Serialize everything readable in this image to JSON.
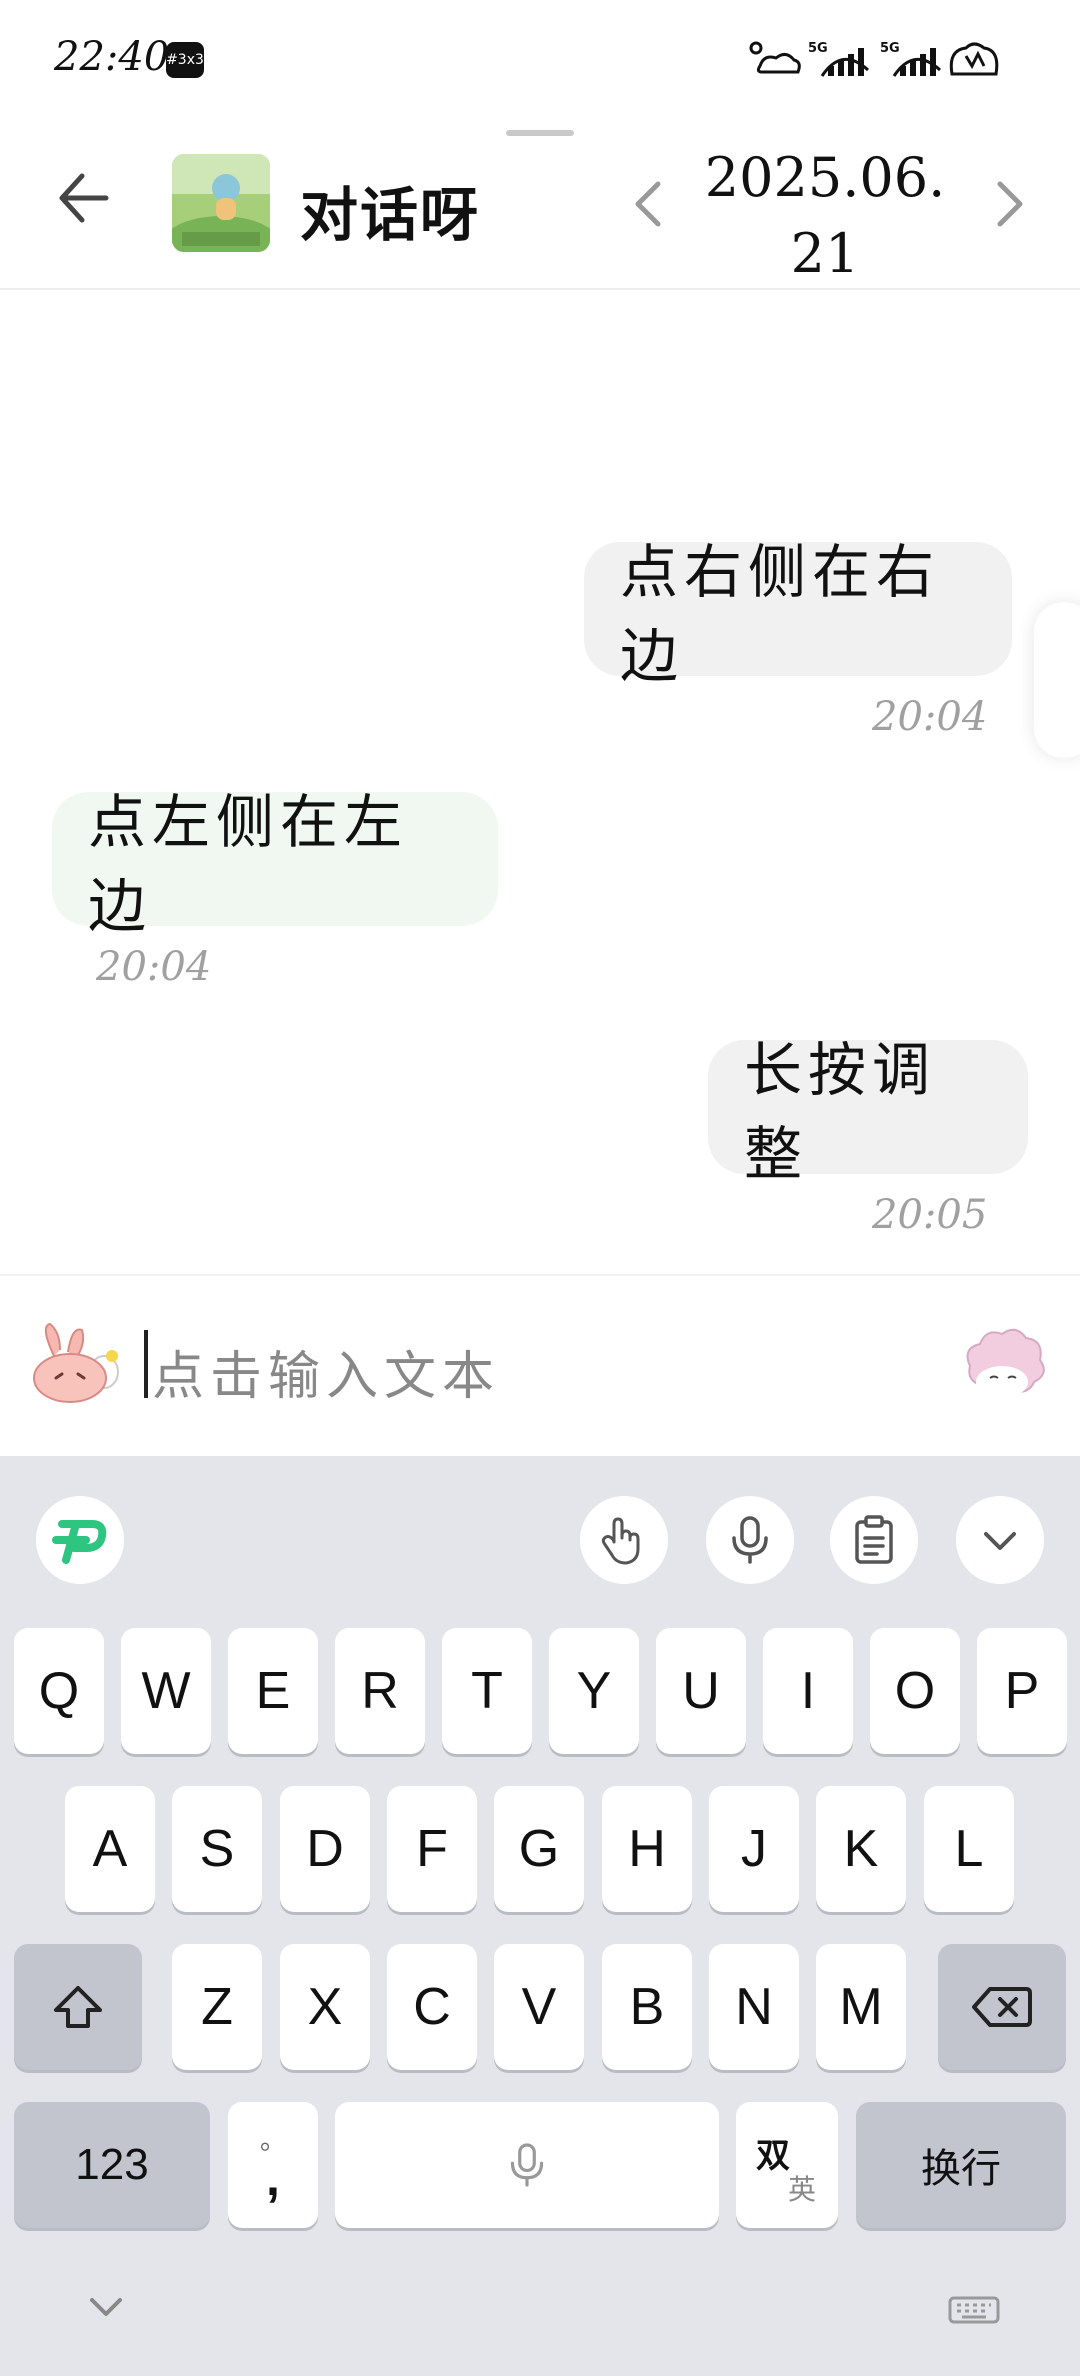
{
  "status_bar": {
    "time": "22:40",
    "badge": "#3x3"
  },
  "header": {
    "title": "对话呀",
    "date": "2025.06.21"
  },
  "messages": [
    {
      "side": "right",
      "text": "点右侧在右边",
      "time": "20:04"
    },
    {
      "side": "left",
      "text": "点左侧在左边",
      "time": "20:04"
    },
    {
      "side": "right",
      "text": "长按调整",
      "time": "20:05"
    }
  ],
  "input": {
    "placeholder": "点击输入文本"
  },
  "keyboard": {
    "row1": [
      "Q",
      "W",
      "E",
      "R",
      "T",
      "Y",
      "U",
      "I",
      "O",
      "P"
    ],
    "row2": [
      "A",
      "S",
      "D",
      "F",
      "G",
      "H",
      "J",
      "K",
      "L"
    ],
    "row3": [
      "Z",
      "X",
      "C",
      "V",
      "B",
      "N",
      "M"
    ],
    "numbers_label": "123",
    "punct_top": "。",
    "punct_bottom": ",",
    "lang_top": "双",
    "lang_bottom": "英",
    "enter_label": "换行",
    "icons": {
      "shift": "shift-icon",
      "backspace": "backspace-icon",
      "space_mic": "mic-icon",
      "gesture": "hand-gesture-icon",
      "mic": "microphone-icon",
      "clipboard": "clipboard-icon",
      "collapse": "chevron-down-icon",
      "hide": "keyboard-icon"
    }
  },
  "colors": {
    "accent_green": "#2dc57f",
    "bubble_right": "#f1f1f1",
    "bubble_left": "#f1f8f1",
    "keyboard_bg": "#e4e5ea"
  }
}
